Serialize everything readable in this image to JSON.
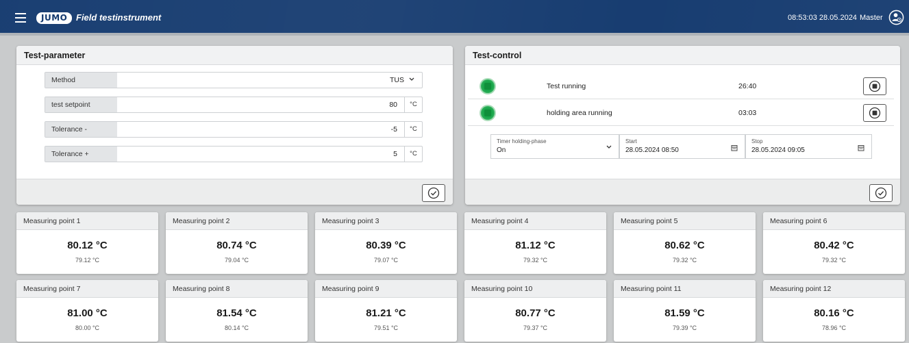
{
  "header": {
    "logo_text": "JUMO",
    "app_title": "Field testinstrument",
    "datetime": "08:53:03 28.05.2024",
    "user": "Master",
    "bg_color": "#13396e"
  },
  "test_parameter": {
    "title": "Test-parameter",
    "rows": [
      {
        "label": "Method",
        "value": "TUS",
        "unit": ""
      },
      {
        "label": "test setpoint",
        "value": "80",
        "unit": "°C"
      },
      {
        "label": "Tolerance -",
        "value": "-5",
        "unit": "°C"
      },
      {
        "label": "Tolerance +",
        "value": "5",
        "unit": "°C"
      }
    ]
  },
  "test_control": {
    "title": "Test-control",
    "rows": [
      {
        "label": "Test running",
        "time": "26:40",
        "status_color": "#19a64a"
      },
      {
        "label": "holding area running",
        "time": "03:03",
        "status_color": "#19a64a"
      }
    ],
    "timer": {
      "label": "Timer holding-phase",
      "value": "On"
    },
    "start": {
      "label": "Start",
      "value": "28.05.2024 08:50"
    },
    "stop": {
      "label": "Stop",
      "value": "28.05.2024 09:05"
    }
  },
  "measuring_points": [
    {
      "name": "Measuring point 1",
      "value": "80.12 °C",
      "sub": "79.12 °C"
    },
    {
      "name": "Measuring point 2",
      "value": "80.74 °C",
      "sub": "79.04 °C"
    },
    {
      "name": "Measuring point 3",
      "value": "80.39 °C",
      "sub": "79.07 °C"
    },
    {
      "name": "Measuring point 4",
      "value": "81.12 °C",
      "sub": "79.32 °C"
    },
    {
      "name": "Measuring point 5",
      "value": "80.62 °C",
      "sub": "79.32 °C"
    },
    {
      "name": "Measuring point 6",
      "value": "80.42 °C",
      "sub": "79.32 °C"
    },
    {
      "name": "Measuring point 7",
      "value": "81.00 °C",
      "sub": "80.00 °C"
    },
    {
      "name": "Measuring point 8",
      "value": "81.54 °C",
      "sub": "80.14 °C"
    },
    {
      "name": "Measuring point 9",
      "value": "81.21 °C",
      "sub": "79.51 °C"
    },
    {
      "name": "Measuring point 10",
      "value": "80.77 °C",
      "sub": "79.37 °C"
    },
    {
      "name": "Measuring point 11",
      "value": "81.59 °C",
      "sub": "79.39 °C"
    },
    {
      "name": "Measuring point 12",
      "value": "80.16 °C",
      "sub": "78.96 °C"
    }
  ]
}
